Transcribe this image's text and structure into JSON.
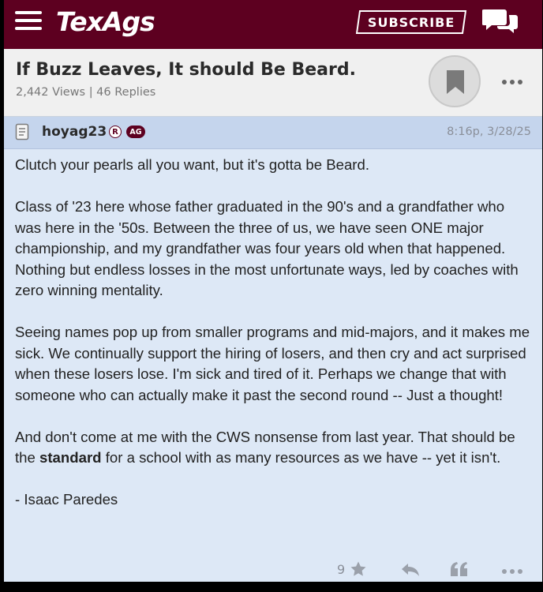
{
  "header": {
    "logo": "TexAgs",
    "subscribe_label": "SUBSCRIBE"
  },
  "thread": {
    "title": "If Buzz Leaves, It should Be Beard.",
    "meta": "2,442 Views | 46 Replies"
  },
  "post": {
    "username": "hoyag23",
    "badge_r": "R",
    "badge_ag": "AG",
    "time": "8:16p, 3/28/25",
    "paragraphs": {
      "p1": "Clutch your pearls all you want, but it's gotta be Beard.",
      "p2": "Class of '23 here whose father graduated in the 90's and a grandfather who was here in the '50s. Between the three of us, we have seen ONE major championship, and my grandfather was four years old when that happened. Nothing but endless losses in the most unfortunate ways, led by coaches with zero winning mentality.",
      "p3": "Seeing names pop up from smaller programs and mid-majors, and it makes me sick. We continually support the hiring of losers, and then cry and act surprised when these losers lose. I'm sick and tired of it. Perhaps we change that with someone who can actually make it past the second round -- Just a thought!",
      "p4_before": "And don't come at me with the CWS nonsense from last year. That should be the ",
      "p4_bold": "standard",
      "p4_after": " for a school with as many resources as we have -- yet it isn't.",
      "p5": "- Isaac Paredes"
    },
    "vote_count": "9"
  },
  "colors": {
    "brand": "#5d0020",
    "post_bg": "#dde8f6",
    "post_header_bg": "#c5d5ed"
  },
  "icons": [
    "hamburger-icon",
    "chat-icon",
    "bookmark-icon",
    "more-icon",
    "user-icon",
    "star-icon",
    "reply-icon",
    "quote-icon"
  ]
}
